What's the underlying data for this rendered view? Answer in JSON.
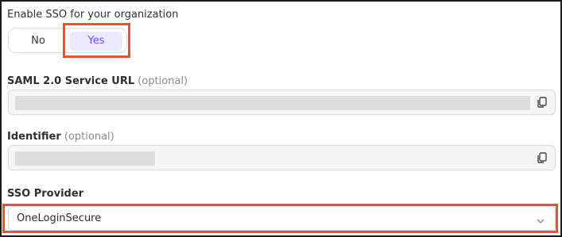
{
  "sso_toggle": {
    "label": "Enable SSO for your organization",
    "options": [
      "No",
      "Yes"
    ],
    "selected": "Yes"
  },
  "saml_url": {
    "label": "SAML 2.0 Service URL",
    "optional_hint": "(optional)",
    "copy_icon": "copy-icon"
  },
  "identifier": {
    "label": "Identifier",
    "optional_hint": "(optional)",
    "copy_icon": "copy-icon"
  },
  "sso_provider": {
    "label": "SSO Provider",
    "selected": "OneLoginSecure",
    "dropdown_icon": "chevron-down-icon"
  },
  "colors": {
    "accent": "#6a50d8",
    "accent_bg": "#ece8fd",
    "highlight": "#e8522e"
  }
}
